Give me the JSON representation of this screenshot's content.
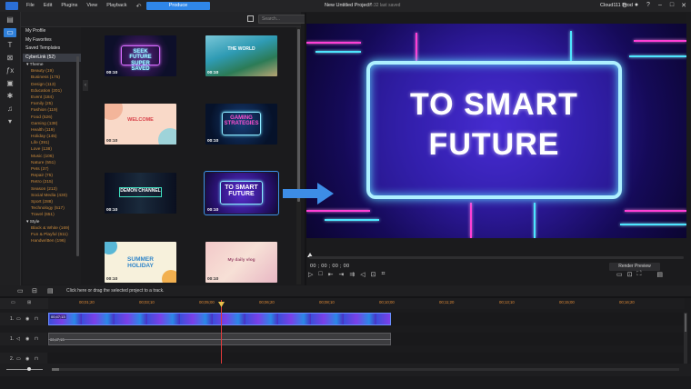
{
  "menu": {
    "items": [
      "File",
      "Edit",
      "Plugins",
      "View",
      "Playback"
    ],
    "produce_label": "Produce",
    "project_name": "New Untitled Project*",
    "project_status": "16:32 last saved",
    "account": "Cloud111 Prod"
  },
  "library": {
    "search_placeholder": "Search...",
    "tree": {
      "top": [
        "My Profile",
        "My Favorites",
        "Saved Templates"
      ],
      "selected": "CyberLink (52)",
      "theme_label": "Theme",
      "themes": [
        "Beauty (19)",
        "Business (175)",
        "Design (113)",
        "Education (201)",
        "Event (184)",
        "Family (25)",
        "Fashion (119)",
        "Food (526)",
        "Gaming (138)",
        "Health (119)",
        "Holiday (145)",
        "Life (391)",
        "Love (138)",
        "Music (106)",
        "Nature (551)",
        "Pets (37)",
        "Repair (75)",
        "Retro (215)",
        "Season (213)",
        "Social Media (430)",
        "Sport (288)",
        "Technology (517)",
        "Travel (651)"
      ],
      "style_label": "Style",
      "styles": [
        "Black & White (169)",
        "Fun & Playful (611)",
        "Handwritten (196)"
      ]
    },
    "thumbnails": [
      {
        "title": "SEEK FUTURE SUPER SAVED",
        "duration": "00:10"
      },
      {
        "title": "THE WORLD",
        "duration": "00:10"
      },
      {
        "title": "WELCOME",
        "duration": "00:10"
      },
      {
        "title": "GAMING STRATEGIES",
        "duration": "00:10"
      },
      {
        "title": "DEMON CHANNEL",
        "duration": "00:10"
      },
      {
        "title": "TO SMART FUTURE",
        "duration": "00:10"
      },
      {
        "title": "SUMMER HOLIDAY",
        "duration": "00:10"
      },
      {
        "title": "My daily vlog",
        "duration": "00:10"
      }
    ]
  },
  "preview": {
    "line1": "TO SMART",
    "line2": "FUTURE",
    "timecode": "00 ; 00 ; 00 ; 00",
    "render_label": "Render Preview"
  },
  "timeline": {
    "hint": "Click here or drag the selected project to a track.",
    "ruler": [
      "00;01;20",
      "00;03;10",
      "00;05;00",
      "00;06;20",
      "00;08;10",
      "00;10;00",
      "00;11;20",
      "00;13;10",
      "00;15;00",
      "00;16;20"
    ],
    "tracks": [
      {
        "label": "1.",
        "clip": "00;47;13"
      },
      {
        "label": "1.",
        "clip": "00;47;13"
      },
      {
        "label": "2."
      }
    ]
  },
  "colors": {
    "accent": "#2f86e8",
    "playhead": "#e03a3a",
    "ruler_text": "#e08a36"
  }
}
